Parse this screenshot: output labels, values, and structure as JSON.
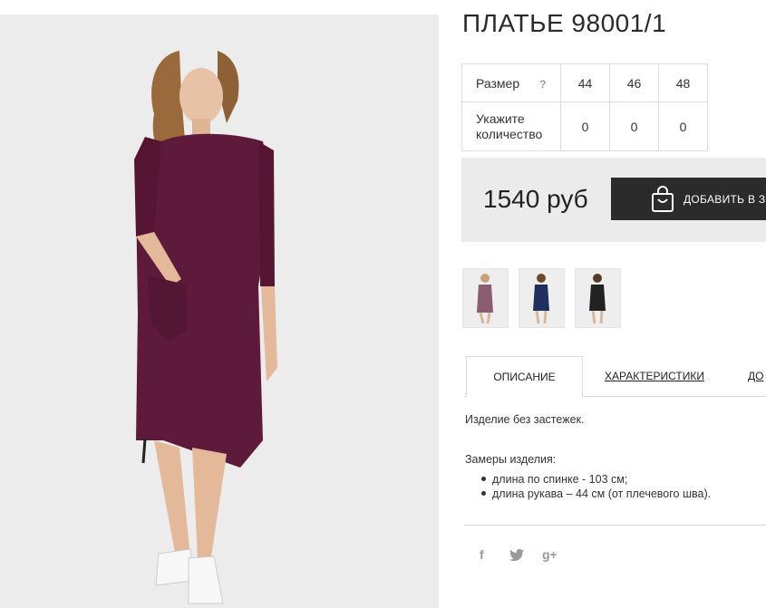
{
  "product": {
    "title": "ПЛАТЬЕ 98001/1"
  },
  "size_table": {
    "size_label": "Размер",
    "help_glyph": "?",
    "sizes": [
      "44",
      "46",
      "48"
    ],
    "quantity_label": "Укажите количество",
    "quantities": [
      "0",
      "0",
      "0"
    ]
  },
  "purchase": {
    "price": "1540 руб",
    "add_to_cart_label": "ДОБАВИТЬ В З",
    "icon": "shopping-bag-icon"
  },
  "thumbnails": [
    {
      "name": "thumbnail-purple-dress",
      "color": "#7a5060"
    },
    {
      "name": "thumbnail-navy-dress",
      "color": "#1f2f5e"
    },
    {
      "name": "thumbnail-black-dress",
      "color": "#222222"
    }
  ],
  "tabs": {
    "description": "ОПИСАНИЕ",
    "characteristics": "ХАРАКТЕРИСТИКИ",
    "third": "ДО"
  },
  "description": {
    "text": "Изделие без застежек.",
    "measurements_title": "Замеры изделия:",
    "measurements": [
      "длина по спинке - 103 см;",
      "длина рукава – 44 см (от плечевого шва)."
    ]
  },
  "social": {
    "facebook": "f",
    "twitter_icon": "twitter-bird-icon",
    "google_plus": "g+"
  },
  "colors": {
    "dress": "#5e1a3a",
    "button": "#2b2b2b",
    "price_bg": "#ebebeb"
  }
}
